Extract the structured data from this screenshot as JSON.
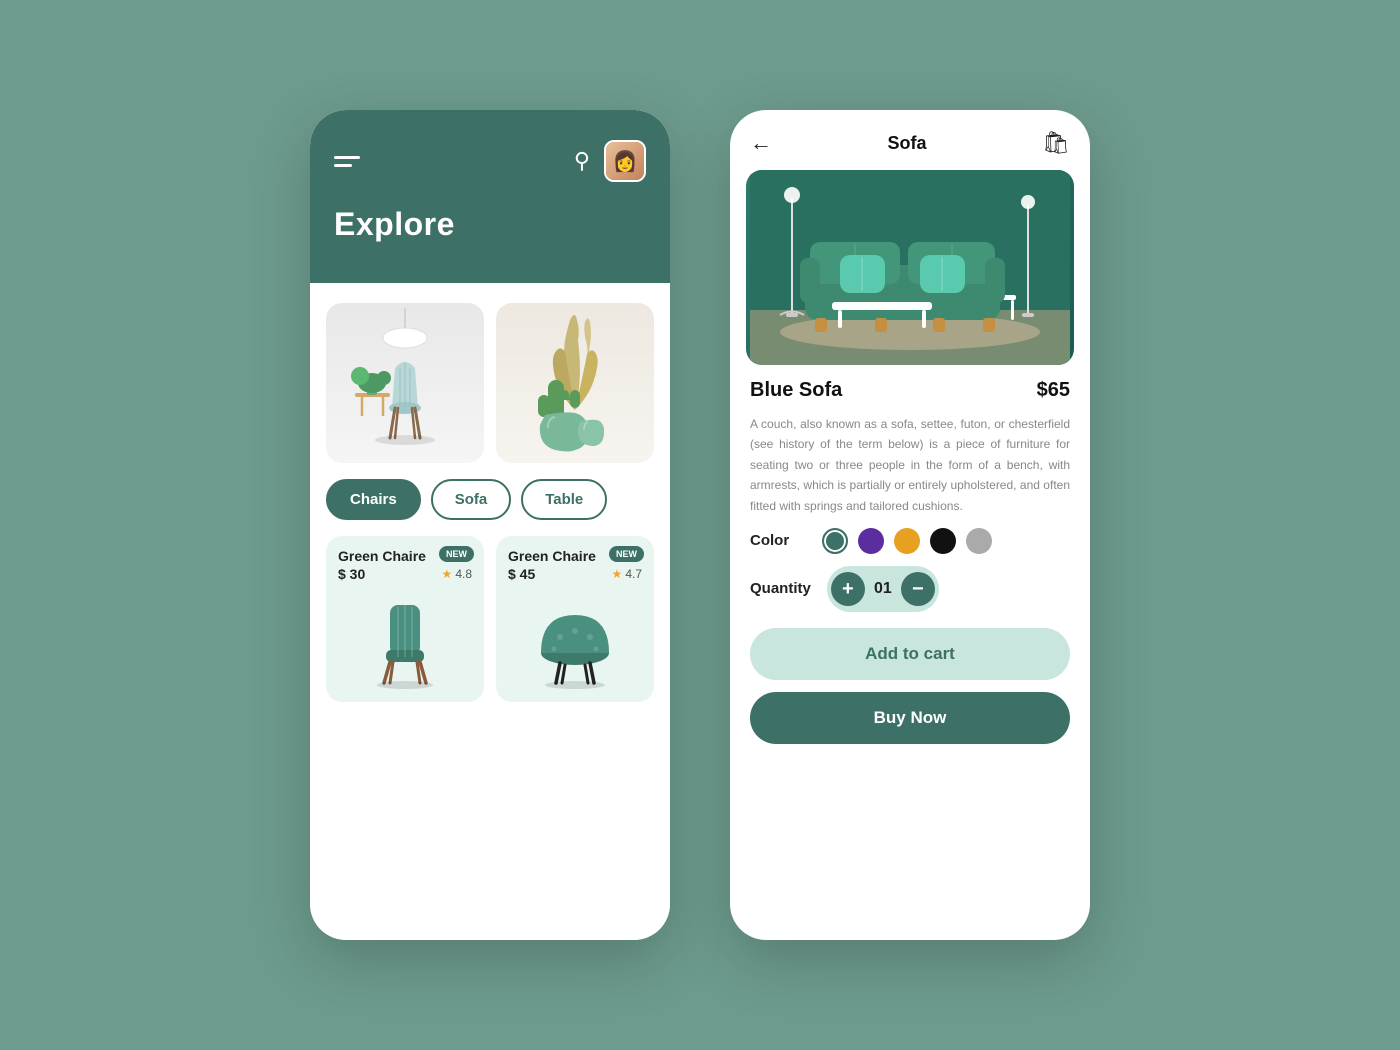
{
  "background_color": "#6d9b8e",
  "left_phone": {
    "header": {
      "explore_label": "Explore"
    },
    "categories": [
      {
        "id": "chairs",
        "label": "Chairs",
        "active": true
      },
      {
        "id": "sofa",
        "label": "Sofa",
        "active": false
      },
      {
        "id": "table",
        "label": "Table",
        "active": false
      }
    ],
    "products": [
      {
        "id": "p1",
        "name": "Green Chaire",
        "price": "$ 30",
        "rating": "4.8",
        "badge": "NEW"
      },
      {
        "id": "p2",
        "name": "Green Chaire",
        "price": "$ 45",
        "rating": "4.7",
        "badge": "NEW"
      }
    ]
  },
  "right_phone": {
    "header": {
      "title": "Sofa"
    },
    "product": {
      "name": "Blue Sofa",
      "price": "$65",
      "description": "A couch, also known as a sofa, settee, futon, or chesterfield (see history of the term below) is a piece of furniture for seating two or three people in the form of a bench, with armrests, which is partially or entirely upholstered, and often fitted with springs and tailored cushions.",
      "color_label": "Color",
      "quantity_label": "Quantity",
      "quantity_value": "01",
      "colors": [
        {
          "id": "green",
          "hex": "#3d7066",
          "selected": true
        },
        {
          "id": "purple",
          "hex": "#5b2d9e"
        },
        {
          "id": "orange",
          "hex": "#e8a020"
        },
        {
          "id": "black",
          "hex": "#111111"
        },
        {
          "id": "gray",
          "hex": "#aaaaaa"
        }
      ],
      "add_to_cart_label": "Add to cart",
      "buy_now_label": "Buy Now"
    }
  }
}
